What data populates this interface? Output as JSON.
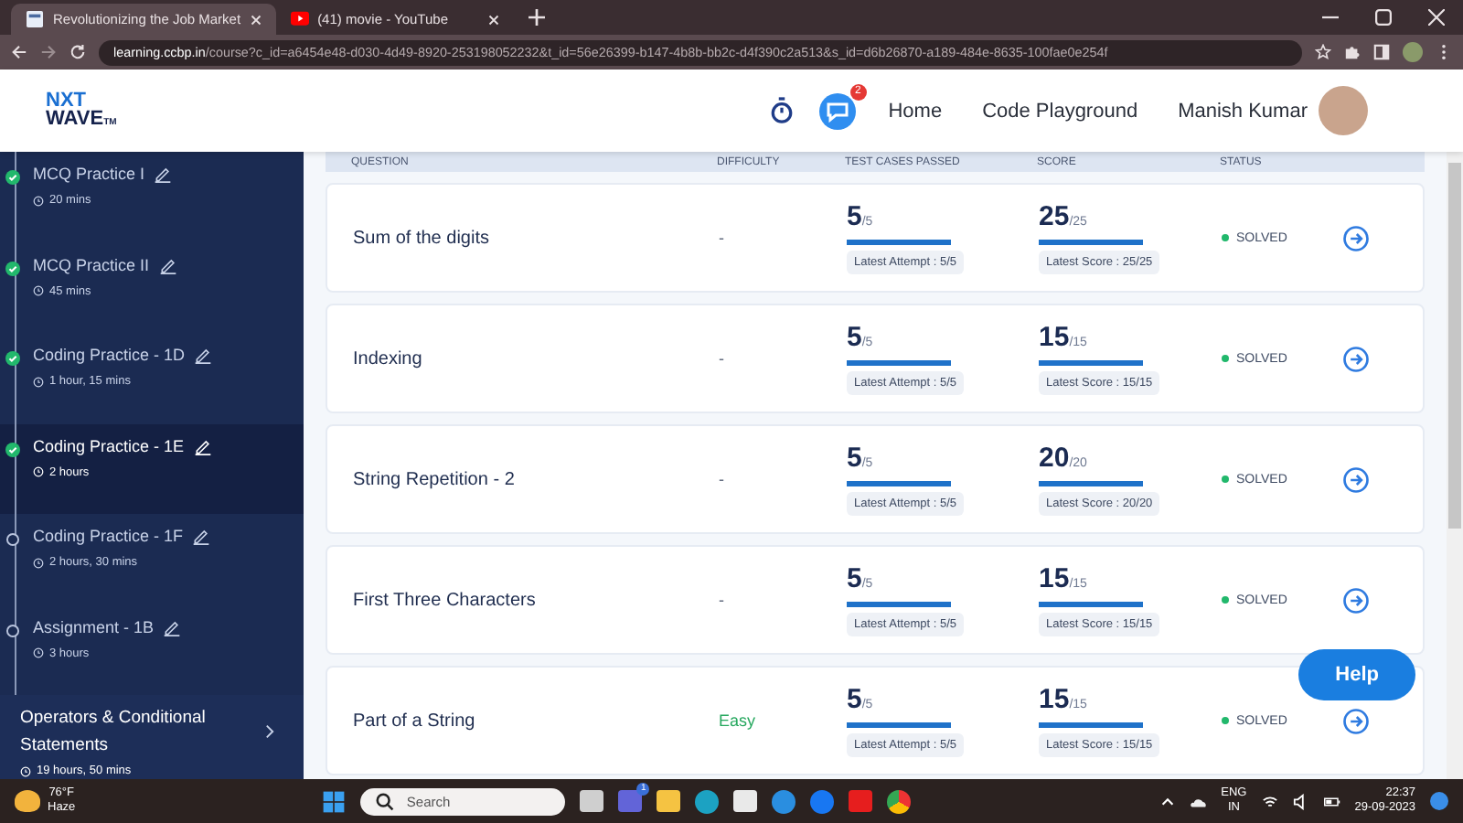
{
  "browser": {
    "tabs": [
      {
        "title": "Revolutionizing the Job Market",
        "selected": true,
        "kind": "page"
      },
      {
        "title": "(41) movie - YouTube",
        "selected": false,
        "kind": "video"
      }
    ],
    "url_host": "learning.ccbp.in",
    "url_path": "/course?c_id=a6454e48-d030-4d49-8920-253198052232&t_id=56e26399-b147-4b8b-bb2c-d4f390c2a513&s_id=d6b26870-a189-484e-8635-100fae0e254f"
  },
  "header": {
    "logo_top": "NXT",
    "logo_bottom": "WAVE",
    "logo_mark": "TM",
    "chat_badge": "2",
    "nav": [
      "Home",
      "Code Playground"
    ],
    "user_name": "Manish Kumar"
  },
  "sidebar": {
    "items": [
      {
        "title": "MCQ Practice I",
        "duration": "20 mins",
        "completed": true,
        "selected": false
      },
      {
        "title": "MCQ Practice II",
        "duration": "45 mins",
        "completed": true,
        "selected": false
      },
      {
        "title": "Coding Practice - 1D",
        "duration": "1 hour, 15 mins",
        "completed": true,
        "selected": false
      },
      {
        "title": "Coding Practice - 1E",
        "duration": "2 hours",
        "completed": true,
        "selected": true
      },
      {
        "title": "Coding Practice - 1F",
        "duration": "2 hours, 30 mins",
        "completed": false,
        "selected": false
      },
      {
        "title": "Assignment - 1B",
        "duration": "3 hours",
        "completed": false,
        "selected": false
      }
    ],
    "section": {
      "title": "Operators & Conditional Statements",
      "duration": "19 hours, 50 mins"
    }
  },
  "table": {
    "columns": [
      "QUESTION",
      "DIFFICULTY",
      "TEST CASES PASSED",
      "SCORE",
      "STATUS"
    ],
    "rows": [
      {
        "question": "Sum of the digits",
        "difficulty": {
          "text": "-",
          "color": "#5a6478"
        },
        "passed": {
          "value": "5",
          "total": "/5",
          "level": 1,
          "latest": "Latest Attempt : 5/5"
        },
        "score": {
          "value": "25",
          "total": "/25",
          "level": 1,
          "latest": "Latest Score : 25/25"
        },
        "status": "SOLVED"
      },
      {
        "question": "Indexing",
        "difficulty": {
          "text": "-",
          "color": "#5a6478"
        },
        "passed": {
          "value": "5",
          "total": "/5",
          "level": 1,
          "latest": "Latest Attempt : 5/5"
        },
        "score": {
          "value": "15",
          "total": "/15",
          "level": 1,
          "latest": "Latest Score : 15/15"
        },
        "status": "SOLVED"
      },
      {
        "question": "String Repetition - 2",
        "difficulty": {
          "text": "-",
          "color": "#5a6478"
        },
        "passed": {
          "value": "5",
          "total": "/5",
          "level": 1,
          "latest": "Latest Attempt : 5/5"
        },
        "score": {
          "value": "20",
          "total": "/20",
          "level": 1,
          "latest": "Latest Score : 20/20"
        },
        "status": "SOLVED"
      },
      {
        "question": "First Three Characters",
        "difficulty": {
          "text": "-",
          "color": "#5a6478"
        },
        "passed": {
          "value": "5",
          "total": "/5",
          "level": 1,
          "latest": "Latest Attempt : 5/5"
        },
        "score": {
          "value": "15",
          "total": "/15",
          "level": 1,
          "latest": "Latest Score : 15/15"
        },
        "status": "SOLVED"
      },
      {
        "question": "Part of a String",
        "difficulty": {
          "text": "Easy",
          "color": "#27a85f"
        },
        "passed": {
          "value": "5",
          "total": "/5",
          "level": 1,
          "latest": "Latest Attempt : 5/5"
        },
        "score": {
          "value": "15",
          "total": "/15",
          "level": 1,
          "latest": "Latest Score : 15/15"
        },
        "status": "SOLVED"
      }
    ]
  },
  "help_button": "Help",
  "taskbar": {
    "temperature": "76°F",
    "weather": "Haze",
    "search_placeholder": "Search",
    "teams_badge": "1",
    "language": "ENG",
    "region": "IN",
    "time": "22:37",
    "date": "29-09-2023"
  }
}
